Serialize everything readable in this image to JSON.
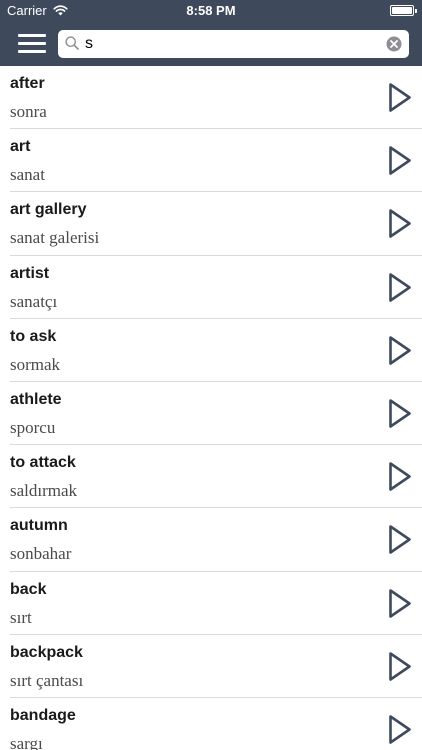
{
  "status_bar": {
    "carrier": "Carrier",
    "time": "8:58 PM",
    "battery_level": 1.0
  },
  "nav_bar": {
    "menu_icon": "hamburger-menu-icon",
    "search_icon": "search-icon",
    "clear_icon": "clear-circle-x-icon",
    "search_value": "s",
    "background_color": "#3e4a5c"
  },
  "words": [
    {
      "en": "after",
      "tr": "sonra"
    },
    {
      "en": "art",
      "tr": "sanat"
    },
    {
      "en": "art gallery",
      "tr": "sanat galerisi"
    },
    {
      "en": "artist",
      "tr": "sanatçı"
    },
    {
      "en": "to ask",
      "tr": "sormak"
    },
    {
      "en": "athlete",
      "tr": "sporcu"
    },
    {
      "en": "to attack",
      "tr": "saldırmak"
    },
    {
      "en": "autumn",
      "tr": "sonbahar"
    },
    {
      "en": "back",
      "tr": "sırt"
    },
    {
      "en": "backpack",
      "tr": "sırt çantası"
    },
    {
      "en": "bandage",
      "tr": "sargı"
    }
  ],
  "row_action_icon": "play-triangle-icon"
}
